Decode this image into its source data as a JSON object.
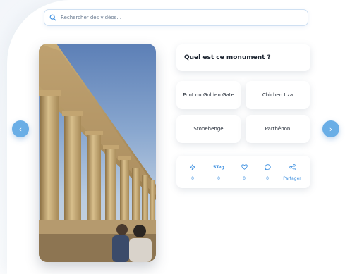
{
  "search": {
    "placeholder": "Rechercher des vidéos..."
  },
  "quiz": {
    "question": "Quel est ce monument ?",
    "answers": [
      "Pont du Golden Gate",
      "Chichen Itza",
      "Stonehenge",
      "Parthénon"
    ]
  },
  "actions": [
    {
      "icon": "lightning-icon",
      "label": "0"
    },
    {
      "icon": "text",
      "label": "5Teg",
      "value": "0"
    },
    {
      "icon": "heart-icon",
      "label": "0"
    },
    {
      "icon": "comment-icon",
      "label": "0"
    },
    {
      "icon": "share-icon",
      "label": "Partager"
    }
  ],
  "nav": {
    "prev": "‹",
    "next": "›"
  },
  "colors": {
    "accent": "#6aaee6",
    "action_blue": "#3a8ee0"
  }
}
